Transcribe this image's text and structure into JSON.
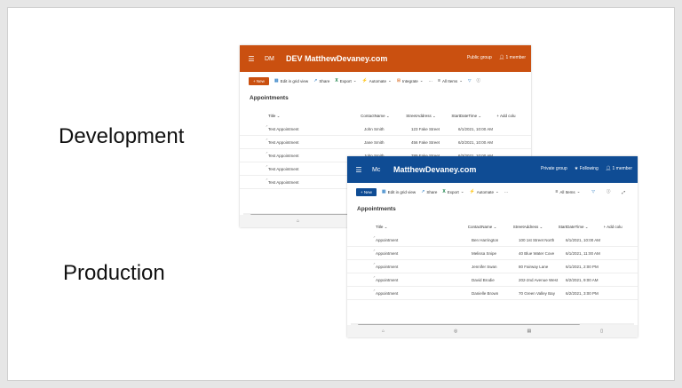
{
  "labels": {
    "development": "Development",
    "production": "Production"
  },
  "dev": {
    "suite": {
      "initials": "DM",
      "title": "DEV MatthewDevaney.com",
      "group": "Public group",
      "members": "1 member"
    },
    "commands": {
      "new": "New",
      "grid": "Edit in grid view",
      "share": "Share",
      "export": "Export",
      "automate": "Automate",
      "integrate": "Integrate",
      "more": "···",
      "view": "All Items"
    },
    "list_title": "Appointments",
    "columns": {
      "title": "Title",
      "contact": "ContactName",
      "street": "StreetAddress",
      "start": "StartDateTime",
      "add": "+ Add colu"
    },
    "rows": [
      {
        "title": "Test Appointment",
        "contact": "John Smith",
        "street": "123 Fake Street",
        "start": "6/1/2021, 10:00 AM"
      },
      {
        "title": "Test Appointment",
        "contact": "Jane Smith",
        "street": "456 Fake Street",
        "start": "6/2/2021, 10:00 AM"
      },
      {
        "title": "Test Appointment",
        "contact": "John Smith",
        "street": "789 Fake Street",
        "start": "6/3/2021, 10:00 AM"
      },
      {
        "title": "Test Appointment",
        "contact": "",
        "street": "",
        "start": ""
      },
      {
        "title": "Test Appointment",
        "contact": "",
        "street": "",
        "start": ""
      }
    ]
  },
  "prod": {
    "suite": {
      "initials": "Mc",
      "title": "MatthewDevaney.com",
      "group": "Private group",
      "following": "Following",
      "members": "1 member"
    },
    "commands": {
      "new": "New",
      "grid": "Edit in grid view",
      "share": "Share",
      "export": "Export",
      "automate": "Automate",
      "more": "···",
      "view": "All Items"
    },
    "list_title": "Appointments",
    "columns": {
      "title": "Title",
      "contact": "ContactName",
      "street": "StreetAddress",
      "start": "StartDateTime",
      "add": "+ Add colu"
    },
    "rows": [
      {
        "title": "Appointment",
        "contact": "Ben Harrington",
        "street": "100 1st Street North",
        "start": "6/1/2021, 10:00 AM"
      },
      {
        "title": "Appointment",
        "contact": "Melissa Snipe",
        "street": "40 Blue Water Cove",
        "start": "6/1/2021, 11:00 AM"
      },
      {
        "title": "Appointment",
        "contact": "Jennifer Swan",
        "street": "80 Fairway Lane",
        "start": "6/1/2021, 2:00 PM"
      },
      {
        "title": "Appointment",
        "contact": "David Brodie",
        "street": "202-2nd Avenue West",
        "start": "6/2/2021, 9:00 AM"
      },
      {
        "title": "Appointment",
        "contact": "Danielle Brown",
        "street": "70 Green Valley Bay",
        "start": "6/2/2021, 3:00 PM"
      }
    ]
  },
  "colors": {
    "dev_accent": "#ca5010",
    "prod_accent": "#0f4c94"
  }
}
